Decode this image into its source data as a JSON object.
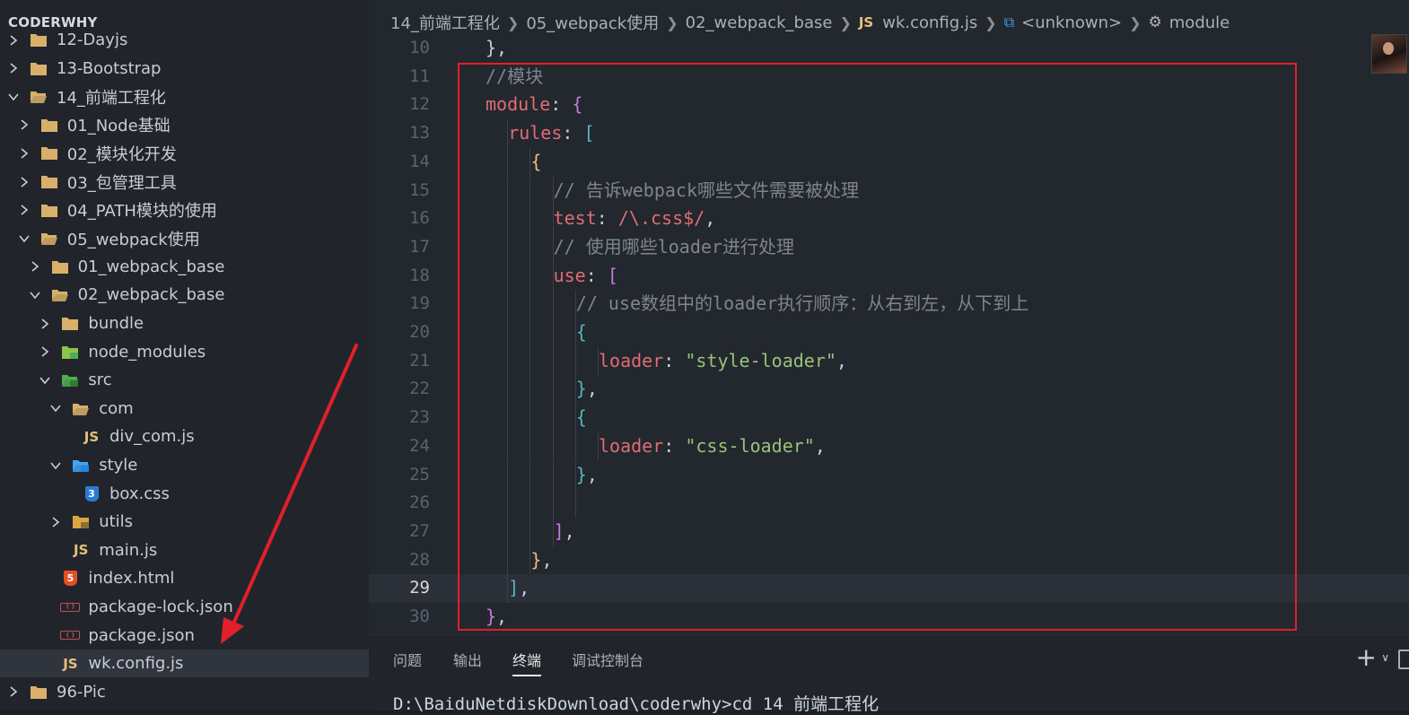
{
  "sidebar": {
    "title": "CODERWHY",
    "items": [
      {
        "label": "12-Dayjs",
        "type": "folder",
        "expanded": false,
        "indent": 0
      },
      {
        "label": "13-Bootstrap",
        "type": "folder",
        "expanded": false,
        "indent": 0
      },
      {
        "label": "14_前端工程化",
        "type": "folder-open",
        "expanded": true,
        "indent": 0
      },
      {
        "label": "01_Node基础",
        "type": "folder",
        "expanded": false,
        "indent": 1
      },
      {
        "label": "02_模块化开发",
        "type": "folder",
        "expanded": false,
        "indent": 1
      },
      {
        "label": "03_包管理工具",
        "type": "folder",
        "expanded": false,
        "indent": 1
      },
      {
        "label": "04_PATH模块的使用",
        "type": "folder",
        "expanded": false,
        "indent": 1
      },
      {
        "label": "05_webpack使用",
        "type": "folder-open",
        "expanded": true,
        "indent": 1
      },
      {
        "label": "01_webpack_base",
        "type": "folder",
        "expanded": false,
        "indent": 2
      },
      {
        "label": "02_webpack_base",
        "type": "folder-open",
        "expanded": true,
        "indent": 2
      },
      {
        "label": "bundle",
        "type": "folder",
        "expanded": false,
        "indent": 3
      },
      {
        "label": "node_modules",
        "type": "folder-node",
        "expanded": false,
        "indent": 3
      },
      {
        "label": "src",
        "type": "folder-src",
        "expanded": true,
        "indent": 3
      },
      {
        "label": "com",
        "type": "folder-open",
        "expanded": true,
        "indent": 4
      },
      {
        "label": "div_com.js",
        "type": "js",
        "indent": 5
      },
      {
        "label": "style",
        "type": "folder-style",
        "expanded": true,
        "indent": 4
      },
      {
        "label": "box.css",
        "type": "css",
        "indent": 5
      },
      {
        "label": "utils",
        "type": "folder-utils",
        "expanded": false,
        "indent": 4
      },
      {
        "label": "main.js",
        "type": "js",
        "indent": 4
      },
      {
        "label": "index.html",
        "type": "html",
        "indent": 3
      },
      {
        "label": "package-lock.json",
        "type": "json",
        "indent": 3
      },
      {
        "label": "package.json",
        "type": "json",
        "indent": 3
      },
      {
        "label": "wk.config.js",
        "type": "js",
        "indent": 3,
        "selected": true
      },
      {
        "label": "96-Pic",
        "type": "folder",
        "expanded": false,
        "indent": 0
      }
    ]
  },
  "breadcrumb": {
    "items": [
      "14_前端工程化",
      "05_webpack使用",
      "02_webpack_base"
    ],
    "file_badge": "JS",
    "file": "wk.config.js",
    "symbol1": "<unknown>",
    "symbol2": "module"
  },
  "editor": {
    "current_line": 29,
    "lines": [
      {
        "n": 10,
        "indent": 1,
        "tokens": [
          [
            "p",
            "},"
          ]
        ]
      },
      {
        "n": 11,
        "indent": 1,
        "tokens": [
          [
            "c",
            "//模块"
          ]
        ]
      },
      {
        "n": 12,
        "indent": 1,
        "tokens": [
          [
            "k",
            "module"
          ],
          [
            "p",
            ": "
          ],
          [
            "m",
            "{"
          ]
        ]
      },
      {
        "n": 13,
        "indent": 2,
        "tokens": [
          [
            "k",
            "rules"
          ],
          [
            "p",
            ": "
          ],
          [
            "b",
            "["
          ]
        ]
      },
      {
        "n": 14,
        "indent": 3,
        "tokens": [
          [
            "y",
            "{"
          ]
        ]
      },
      {
        "n": 15,
        "indent": 4,
        "tokens": [
          [
            "c",
            "// 告诉webpack哪些文件需要被处理"
          ]
        ]
      },
      {
        "n": 16,
        "indent": 4,
        "tokens": [
          [
            "k",
            "test"
          ],
          [
            "p",
            ": "
          ],
          [
            "r",
            "/\\.css$/"
          ],
          [
            "p",
            ","
          ]
        ]
      },
      {
        "n": 17,
        "indent": 4,
        "tokens": [
          [
            "c",
            "// 使用哪些loader进行处理"
          ]
        ]
      },
      {
        "n": 18,
        "indent": 4,
        "tokens": [
          [
            "k",
            "use"
          ],
          [
            "p",
            ": "
          ],
          [
            "m",
            "["
          ]
        ]
      },
      {
        "n": 19,
        "indent": 5,
        "tokens": [
          [
            "c",
            "// use数组中的loader执行顺序：从右到左，从下到上"
          ]
        ]
      },
      {
        "n": 20,
        "indent": 5,
        "tokens": [
          [
            "b",
            "{"
          ]
        ]
      },
      {
        "n": 21,
        "indent": 6,
        "tokens": [
          [
            "k",
            "loader"
          ],
          [
            "p",
            ": "
          ],
          [
            "s",
            "\"style-loader\""
          ],
          [
            "p",
            ","
          ]
        ]
      },
      {
        "n": 22,
        "indent": 5,
        "tokens": [
          [
            "b",
            "}"
          ],
          [
            "p",
            ","
          ]
        ]
      },
      {
        "n": 23,
        "indent": 5,
        "tokens": [
          [
            "b",
            "{"
          ]
        ]
      },
      {
        "n": 24,
        "indent": 6,
        "tokens": [
          [
            "k",
            "loader"
          ],
          [
            "p",
            ": "
          ],
          [
            "s",
            "\"css-loader\""
          ],
          [
            "p",
            ","
          ]
        ]
      },
      {
        "n": 25,
        "indent": 5,
        "tokens": [
          [
            "b",
            "}"
          ],
          [
            "p",
            ","
          ]
        ]
      },
      {
        "n": 26,
        "indent": 5,
        "tokens": []
      },
      {
        "n": 27,
        "indent": 4,
        "tokens": [
          [
            "m",
            "]"
          ],
          [
            "p",
            ","
          ]
        ]
      },
      {
        "n": 28,
        "indent": 3,
        "tokens": [
          [
            "y",
            "}"
          ],
          [
            "p",
            ","
          ]
        ]
      },
      {
        "n": 29,
        "indent": 2,
        "tokens": [
          [
            "b",
            "]"
          ],
          [
            "p",
            ","
          ]
        ]
      },
      {
        "n": 30,
        "indent": 1,
        "tokens": [
          [
            "m",
            "}"
          ],
          [
            "p",
            ","
          ]
        ]
      }
    ]
  },
  "panel": {
    "tabs": [
      "问题",
      "输出",
      "终端",
      "调试控制台"
    ],
    "active_tab": "终端",
    "plus": "+",
    "terminal_text": "D:\\BaiduNetdiskDownload\\coderwhy>cd 14 前端工程化"
  },
  "colors": {
    "accent_red": "#e0202a",
    "keyword": "#e06c75",
    "string": "#98c379",
    "comment": "#7f848e",
    "js_icon": "#e5c07b"
  }
}
